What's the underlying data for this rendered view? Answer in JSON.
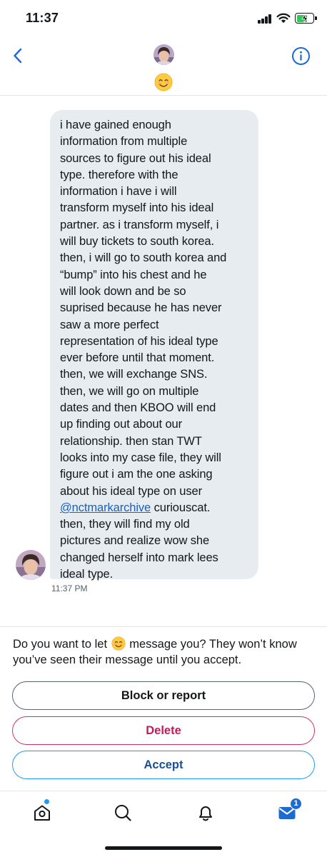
{
  "status_bar": {
    "time": "11:37",
    "battery_level": 0.7,
    "battery_charging": true
  },
  "header": {
    "back_icon": "chevron-left-icon",
    "info_icon": "info-circle-icon",
    "display_name_emoji": "smiling-face-emoji",
    "accent_color": "#1d6ad0"
  },
  "message": {
    "lines": [
      "i have gained enough",
      "information from multiple",
      "sources to figure out his ideal",
      "type. therefore with the",
      "information i have i will",
      "transform myself into his ideal",
      "partner. as i transform myself, i",
      "will buy tickets to south korea.",
      "then, i will go to south korea and",
      "“bump” into his chest and he",
      "will look down and be so",
      "suprised because he has never",
      "saw a more perfect",
      "representation of his ideal type",
      "ever before until that moment.",
      "then, we will exchange SNS.",
      "then, we will go on multiple",
      "dates and then KBOO will end",
      "up finding out about our",
      "relationship. then stan TWT",
      "looks into my case file, they will",
      "figure out i am the one asking",
      "about his ideal type on user"
    ],
    "mention": "@nctmarkarchive",
    "mention_after": " curiouscat.",
    "lines_after": [
      "then, they will find my old",
      "pictures and realize wow she",
      "changed herself into mark lees",
      "ideal type."
    ],
    "timestamp": "11:37 PM",
    "bubble_color": "#e6ecf0"
  },
  "request": {
    "prompt_before": "Do you want to let ",
    "prompt_after": " message you? They won’t know you’ve seen their message until you accept.",
    "block_label": "Block or report",
    "delete_label": "Delete",
    "accept_label": "Accept",
    "delete_color": "#c4195b",
    "accept_color": "#1a4f9c"
  },
  "tab_bar": {
    "items": [
      {
        "name": "home",
        "icon": "home-icon",
        "has_dot": true
      },
      {
        "name": "search",
        "icon": "search-icon"
      },
      {
        "name": "notifications",
        "icon": "bell-icon"
      },
      {
        "name": "messages",
        "icon": "envelope-icon",
        "active": true,
        "badge": "1"
      }
    ]
  }
}
